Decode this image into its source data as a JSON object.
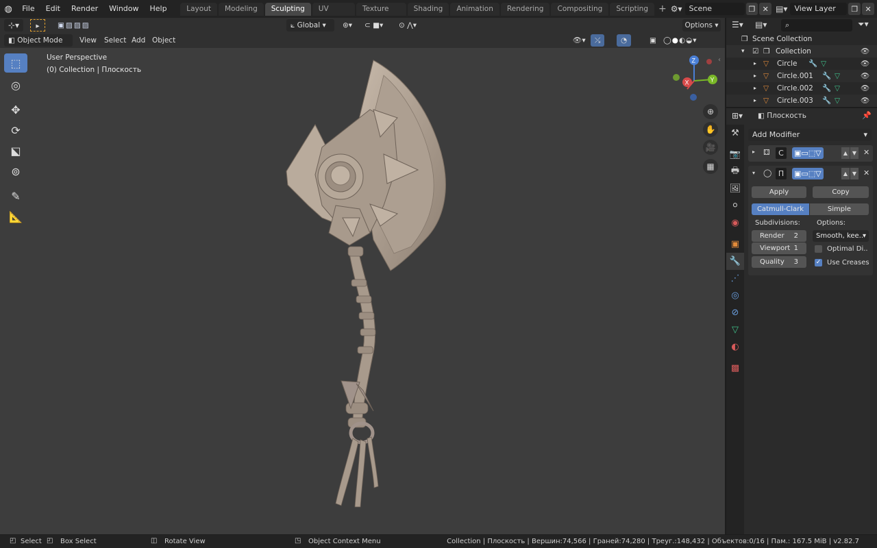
{
  "topbar": {
    "menu": [
      "File",
      "Edit",
      "Render",
      "Window",
      "Help"
    ],
    "tabs": [
      "Layout",
      "Modeling",
      "Sculpting",
      "UV Editing",
      "Texture Paint",
      "Shading",
      "Animation",
      "Rendering",
      "Compositing",
      "Scripting"
    ],
    "add_tab": "+",
    "scene": "Scene",
    "view_layer": "View Layer"
  },
  "viewport_header": {
    "mode": "Object Mode",
    "menu": [
      "View",
      "Select",
      "Add",
      "Object"
    ],
    "orientation": "Global",
    "options": "Options"
  },
  "viewport": {
    "perspective": "User Perspective",
    "collection": "(0) Collection | Плоскость",
    "gizmo": {
      "z": "Z",
      "y": "Y",
      "x": "X"
    }
  },
  "outliner": {
    "scene_collection": "Scene Collection",
    "collection": "Collection",
    "objects": [
      "Circle",
      "Circle.001",
      "Circle.002",
      "Circle.003"
    ]
  },
  "properties": {
    "object_name": "Плоскость",
    "add_modifier": "Add Modifier",
    "modifier1_letter": "C",
    "modifier2_letter": "П",
    "apply": "Apply",
    "copy": "Copy",
    "catmull": "Catmull-Clark",
    "simple": "Simple",
    "subdivisions": "Subdivisions:",
    "options": "Options:",
    "render_label": "Render",
    "render_value": "2",
    "viewport_label": "Viewport",
    "viewport_value": "1",
    "quality_label": "Quality",
    "quality_value": "3",
    "uv_smooth": "Smooth, kee..",
    "optimal": "Optimal Di..",
    "use_creases": "Use Creases"
  },
  "status": {
    "select": "Select",
    "box_select": "Box Select",
    "rotate": "Rotate View",
    "context": "Object Context Menu",
    "stats": "Collection | Плоскость | Вершин:74,566 | Граней:74,280 | Треуг.:148,432 | Объектов:0/16 | Пам.: 167.5 MiB | v2.82.7"
  },
  "colors": {
    "accent": "#5680c2",
    "viewport_bg": "#3d3d3d",
    "mesh": "#b5a89a"
  }
}
